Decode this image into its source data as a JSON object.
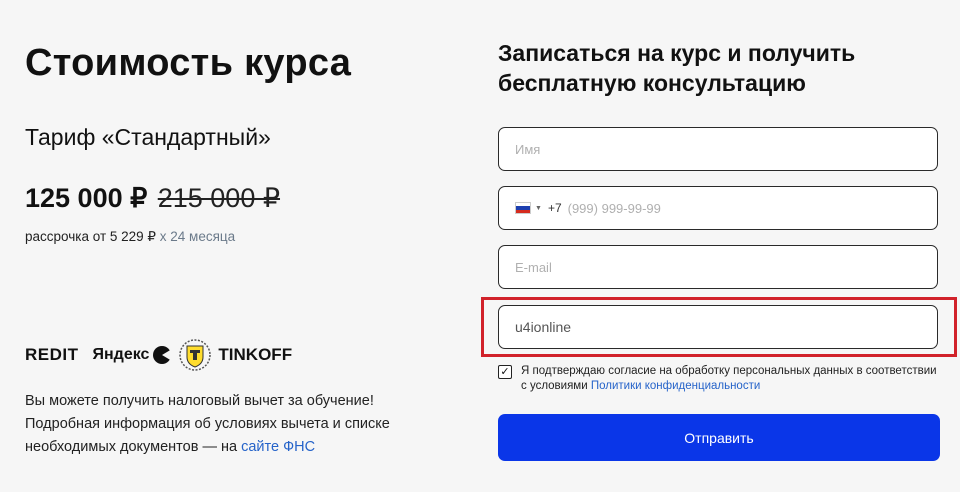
{
  "pricing": {
    "title": "Стоимость курса",
    "tariff": "Тариф «Стандартный»",
    "price_new": "125 000 ₽",
    "price_old": "215 000 ₽",
    "installment_prefix": "рассрочка от 5 229 ₽",
    "installment_accent": "х 24 месяца"
  },
  "partners": {
    "credit_logo": "REDIT",
    "yandex_logo": "Яндекс",
    "tinkoff_logo": "TINKOFF"
  },
  "tax": {
    "text": "Вы можете получить налоговый вычет за обучение! Подробная информация об условиях вычета и списке необходимых документов — на ",
    "link": "сайте ФНС"
  },
  "form": {
    "title_line1": "Записаться на курс и получить",
    "title_line2": "бесплатную консультацию",
    "name_placeholder": "Имя",
    "phone_code": "+7",
    "phone_placeholder": "(999) 999-99-99",
    "email_placeholder": "E-mail",
    "extra_value": "u4ionline",
    "consent_checked": true,
    "consent_text": "Я подтверждаю согласие на обработку персональных данных в соответствии с условиями ",
    "consent_link": "Политики конфиденциальности",
    "submit_label": "Отправить"
  },
  "colors": {
    "accent_blue": "#0a36e8",
    "link_blue": "#2563c9",
    "highlight_red": "#d1222a"
  }
}
